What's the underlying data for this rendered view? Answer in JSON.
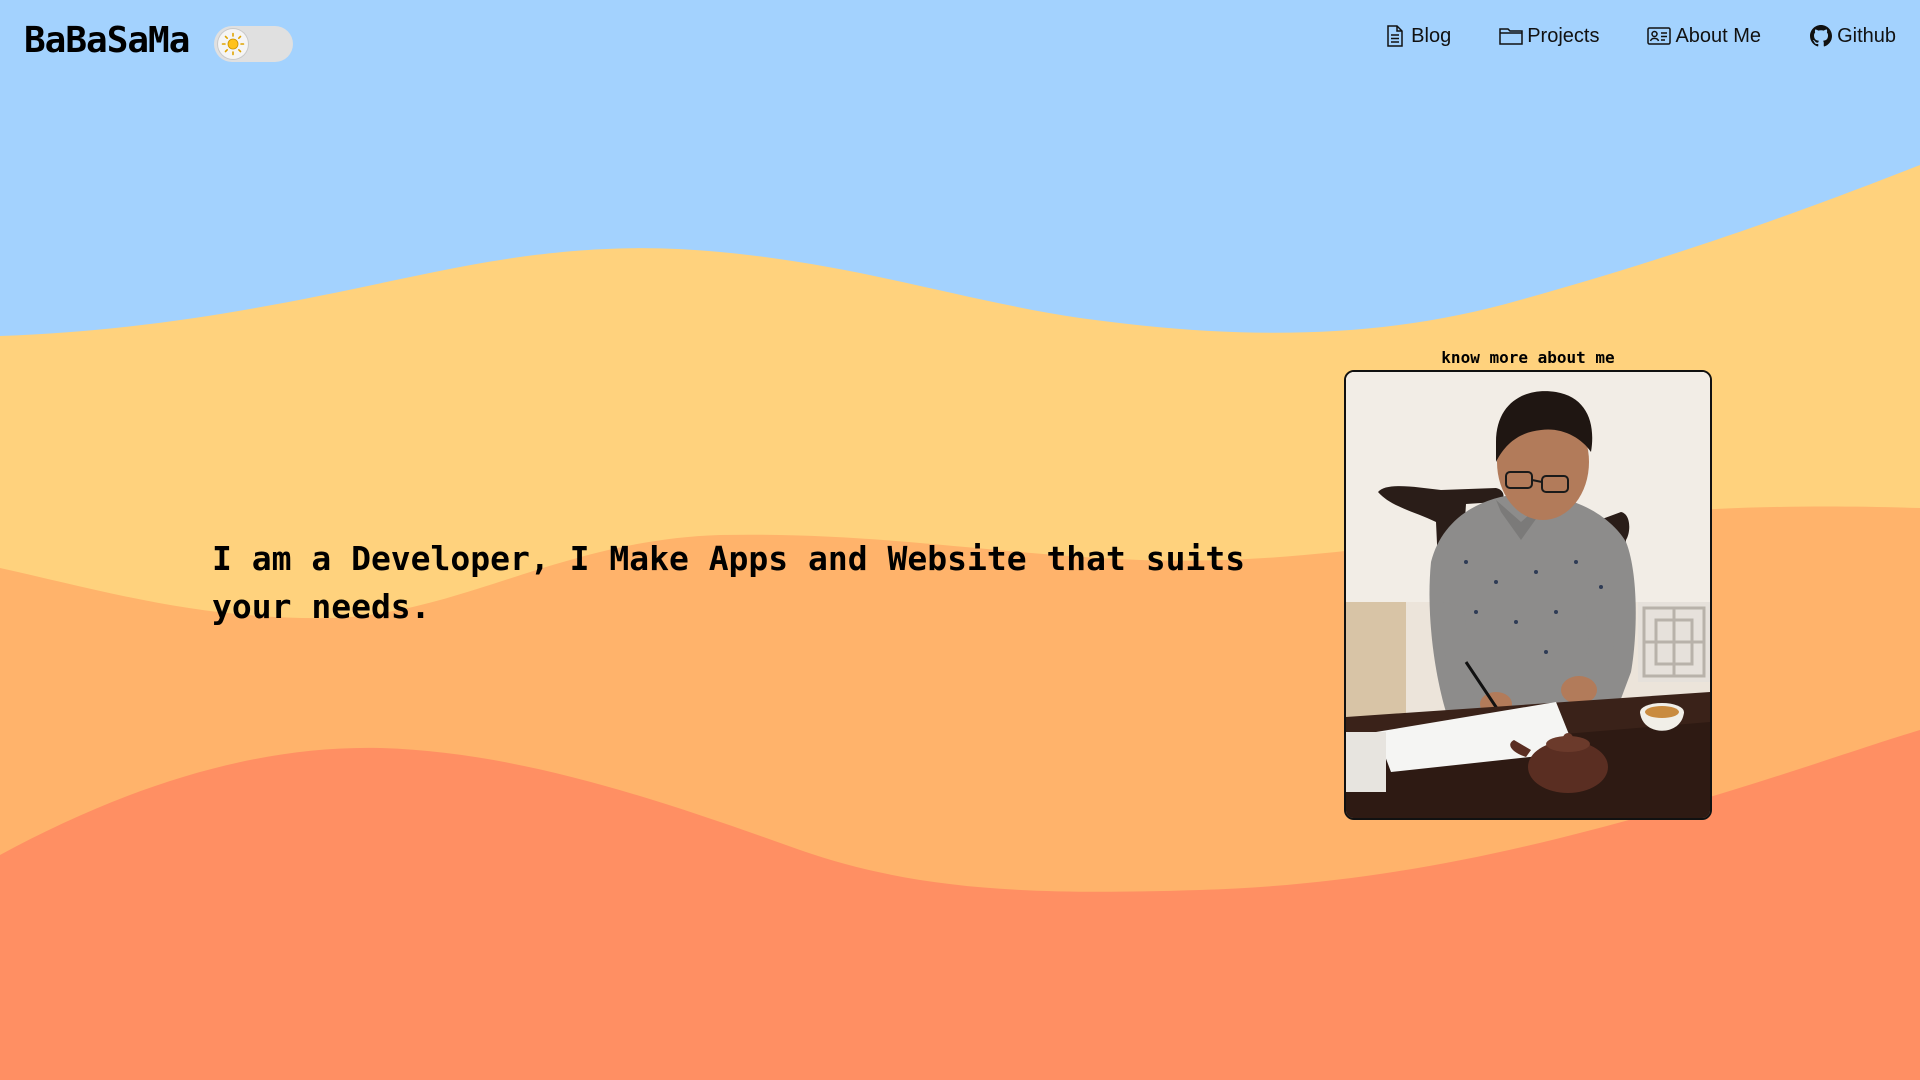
{
  "header": {
    "brand": "BaBaSaMa",
    "theme_toggle": {
      "state": "light",
      "icon": "sun-icon"
    },
    "nav": [
      {
        "label": "Blog",
        "icon": "document-icon"
      },
      {
        "label": "Projects",
        "icon": "folder-icon"
      },
      {
        "label": "About Me",
        "icon": "id-card-icon"
      },
      {
        "label": "Github",
        "icon": "github-icon"
      }
    ]
  },
  "hero": {
    "headline": "I am a Developer, I Make Apps and Website that suits your needs.",
    "about_caption": "know more about me",
    "photo_icon": "person-writing-photo"
  },
  "colors": {
    "sky": "#a3d2fe",
    "wave_1": "#ffd27d",
    "wave_2": "#ffb36b",
    "wave_3": "#ff8f63",
    "text": "#000000"
  }
}
